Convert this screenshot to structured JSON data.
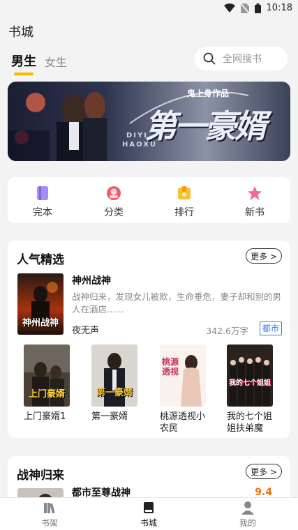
{
  "status": {
    "time": "10:18"
  },
  "header": {
    "title": "书城"
  },
  "tabs": [
    {
      "label": "男生",
      "active": true
    },
    {
      "label": "女生",
      "active": false
    }
  ],
  "search": {
    "placeholder": "全网搜书",
    "icon": "search-icon"
  },
  "banner": {
    "title": "第一豪婿",
    "subtitle": "鬼上身作品",
    "pinyin_line1": "DIYI",
    "pinyin_line2": "HAOXU"
  },
  "quick_links": [
    {
      "label": "完本",
      "icon": "book-complete-icon",
      "color": "#9b7cf0"
    },
    {
      "label": "分类",
      "icon": "category-icon",
      "color": "#ef5b6b"
    },
    {
      "label": "排行",
      "icon": "ranking-icon",
      "color": "#f5b800"
    },
    {
      "label": "新书",
      "icon": "star-icon",
      "color": "#f0558e"
    }
  ],
  "popular": {
    "title": "人气精选",
    "more_label": "更多 >",
    "featured": {
      "title": "神州战神",
      "cover_text": "神州战神",
      "description": "战神归来，发现女儿被欺，生命垂危，妻子却和别的男人在酒店……",
      "author": "夜无声",
      "words": "342.6万字",
      "tag": "都市"
    },
    "books": [
      {
        "title": "上门豪婿1",
        "cover_text": "上门豪婿"
      },
      {
        "title": "第一豪婿",
        "cover_text": "第一豪婿"
      },
      {
        "title": "桃源透视小农民",
        "cover_text": "桃源透视"
      },
      {
        "title": "我的七个姐姐扶弟魔",
        "cover_text": "我的七个姐姐"
      }
    ]
  },
  "section2": {
    "title": "战神归来",
    "more_label": "更多 >",
    "book_title": "都市至尊战神",
    "score": "9.4"
  },
  "bottom_nav": [
    {
      "label": "书架",
      "icon": "bookshelf-icon",
      "active": false
    },
    {
      "label": "书城",
      "icon": "bookstore-icon",
      "active": true
    },
    {
      "label": "我的",
      "icon": "profile-icon",
      "active": false
    }
  ],
  "colors": {
    "accent": "#f5b800",
    "tag_blue": "#3b7be8",
    "score_orange": "#ff6a00"
  }
}
